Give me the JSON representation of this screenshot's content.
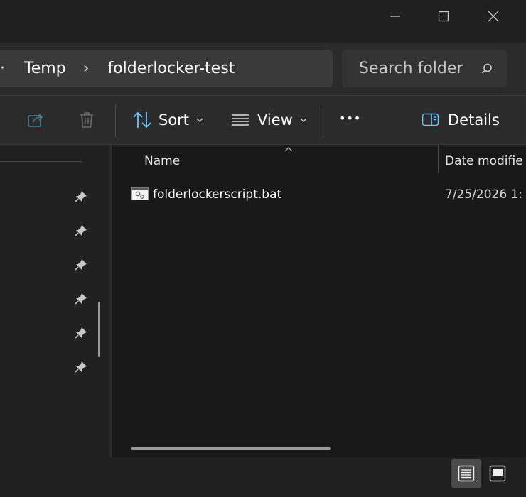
{
  "window": {
    "minimize_icon": "minimize-icon",
    "maximize_icon": "maximize-icon",
    "close_icon": "close-icon"
  },
  "address": {
    "overflow_glyph": "·",
    "crumbs": [
      "Temp",
      "folderlocker-test"
    ],
    "separator": "›"
  },
  "search": {
    "placeholder": "Search folder"
  },
  "toolbar": {
    "sort_label": "Sort",
    "view_label": "View",
    "more_label": "•••",
    "details_label": "Details"
  },
  "columns": {
    "name": "Name",
    "date_modified": "Date modifie"
  },
  "files": [
    {
      "name": "folderlockerscript.bat",
      "date": "7/25/2026 1:"
    }
  ],
  "colors": {
    "background": "#191919",
    "chrome": "#2b2b2b",
    "accent": "#4cc2ff"
  }
}
